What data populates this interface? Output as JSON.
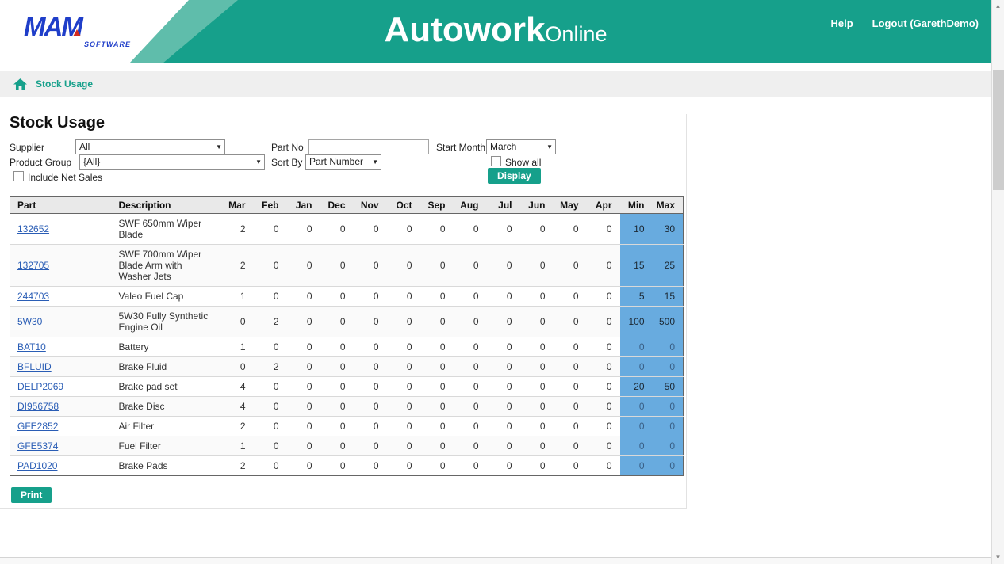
{
  "colors": {
    "accent_teal": "#16a08b",
    "link_blue": "#2a5db5",
    "minmax_blue": "#68abdf",
    "logo_blue": "#1f3ec9"
  },
  "header": {
    "brand_name": "MAM",
    "brand_sub": "SOFTWARE",
    "app_title_main": "Autowork",
    "app_title_sub": "Online",
    "help_label": "Help",
    "logout_label": "Logout (GarethDemo)"
  },
  "breadcrumb": {
    "label": "Stock Usage"
  },
  "page": {
    "title": "Stock Usage"
  },
  "filters": {
    "supplier": {
      "label": "Supplier",
      "value": "All"
    },
    "part_no": {
      "label": "Part No",
      "value": ""
    },
    "start_month": {
      "label": "Start Month",
      "value": "March"
    },
    "product_group": {
      "label": "Product Group",
      "value": "{All}"
    },
    "sort_by": {
      "label": "Sort By",
      "value": "Part Number"
    },
    "show_all": {
      "label": "Show all",
      "checked": false
    },
    "include_net_sales": {
      "label": "Include Net Sales",
      "checked": false
    },
    "display_button": "Display"
  },
  "table": {
    "columns": [
      "Part",
      "Description",
      "Mar",
      "Feb",
      "Jan",
      "Dec",
      "Nov",
      "Oct",
      "Sep",
      "Aug",
      "Jul",
      "Jun",
      "May",
      "Apr",
      "Min",
      "Max"
    ],
    "rows": [
      {
        "part": "132652",
        "description": "SWF 650mm Wiper Blade",
        "months": [
          2,
          0,
          0,
          0,
          0,
          0,
          0,
          0,
          0,
          0,
          0,
          0
        ],
        "min": 10,
        "max": 30
      },
      {
        "part": "132705",
        "description": "SWF 700mm Wiper Blade Arm with Washer Jets",
        "months": [
          2,
          0,
          0,
          0,
          0,
          0,
          0,
          0,
          0,
          0,
          0,
          0
        ],
        "min": 15,
        "max": 25
      },
      {
        "part": "244703",
        "description": "Valeo Fuel Cap",
        "months": [
          1,
          0,
          0,
          0,
          0,
          0,
          0,
          0,
          0,
          0,
          0,
          0
        ],
        "min": 5,
        "max": 15
      },
      {
        "part": "5W30",
        "description": "5W30 Fully Synthetic Engine Oil",
        "months": [
          0,
          2,
          0,
          0,
          0,
          0,
          0,
          0,
          0,
          0,
          0,
          0
        ],
        "min": 100,
        "max": 500
      },
      {
        "part": "BAT10",
        "description": "Battery",
        "months": [
          1,
          0,
          0,
          0,
          0,
          0,
          0,
          0,
          0,
          0,
          0,
          0
        ],
        "min": 0,
        "max": 0
      },
      {
        "part": "BFLUID",
        "description": "Brake Fluid",
        "months": [
          0,
          2,
          0,
          0,
          0,
          0,
          0,
          0,
          0,
          0,
          0,
          0
        ],
        "min": 0,
        "max": 0
      },
      {
        "part": "DELP2069",
        "description": "Brake pad set",
        "months": [
          4,
          0,
          0,
          0,
          0,
          0,
          0,
          0,
          0,
          0,
          0,
          0
        ],
        "min": 20,
        "max": 50
      },
      {
        "part": "DI956758",
        "description": "Brake Disc",
        "months": [
          4,
          0,
          0,
          0,
          0,
          0,
          0,
          0,
          0,
          0,
          0,
          0
        ],
        "min": 0,
        "max": 0
      },
      {
        "part": "GFE2852",
        "description": "Air Filter",
        "months": [
          2,
          0,
          0,
          0,
          0,
          0,
          0,
          0,
          0,
          0,
          0,
          0
        ],
        "min": 0,
        "max": 0
      },
      {
        "part": "GFE5374",
        "description": "Fuel Filter",
        "months": [
          1,
          0,
          0,
          0,
          0,
          0,
          0,
          0,
          0,
          0,
          0,
          0
        ],
        "min": 0,
        "max": 0
      },
      {
        "part": "PAD1020",
        "description": "Brake Pads",
        "months": [
          2,
          0,
          0,
          0,
          0,
          0,
          0,
          0,
          0,
          0,
          0,
          0
        ],
        "min": 0,
        "max": 0
      }
    ]
  },
  "buttons": {
    "print": "Print"
  }
}
